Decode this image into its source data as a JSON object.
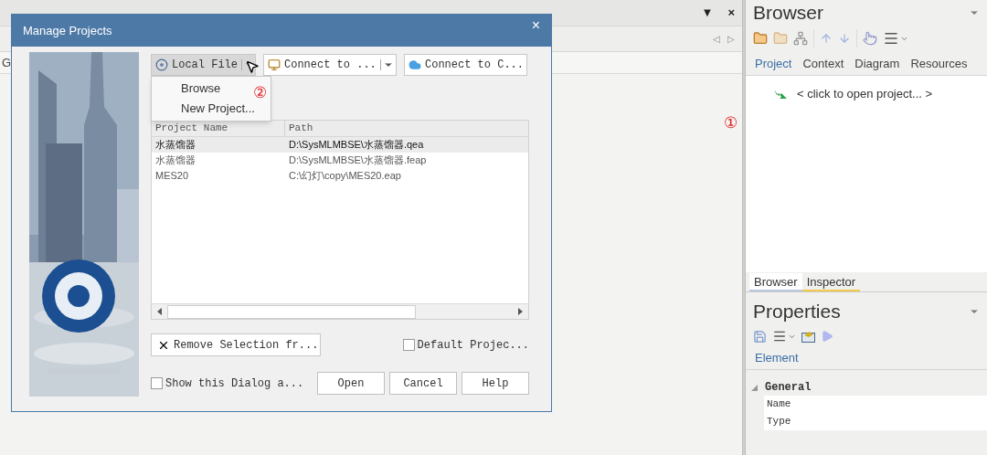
{
  "background": {
    "top_glyphs": [
      "▼",
      "×"
    ],
    "nav_glyphs": [
      "◁",
      "▷"
    ],
    "tab_label": "G"
  },
  "annotations": [
    "①",
    "②"
  ],
  "dialog": {
    "title": "Manage Projects",
    "close": "×",
    "sources": [
      {
        "label": "Local File",
        "kind": "split"
      },
      {
        "label": "Connect to ...",
        "kind": "split"
      },
      {
        "label": "Connect to C...",
        "kind": "plain"
      }
    ],
    "menu": [
      "Browse",
      "New Project..."
    ],
    "columns": [
      "Project Name",
      "Path"
    ],
    "rows": [
      {
        "name": "水蒸馏器",
        "path": "D:\\SysMLMBSE\\水蒸馏器.qea",
        "selected": true
      },
      {
        "name": "水蒸馏器",
        "path": "D:\\SysMLMBSE\\水蒸馏器.feap",
        "selected": false
      },
      {
        "name": "MES20",
        "path": "C:\\幻灯\\copy\\MES20.eap",
        "selected": false
      }
    ],
    "remove_button": "Remove Selection fr...",
    "default_checkbox": {
      "label": "Default Projec...",
      "checked": false
    },
    "show_checkbox": {
      "label": "Show this Dialog a...",
      "checked": false
    },
    "buttons": [
      "Open",
      "Cancel",
      "Help"
    ]
  },
  "browser": {
    "title": "Browser",
    "tabs": [
      {
        "label": "Project",
        "selected": true
      },
      {
        "label": "Context",
        "selected": false
      },
      {
        "label": "Diagram",
        "selected": false
      },
      {
        "label": "Resources",
        "selected": false
      }
    ],
    "item": "< click to open project... >",
    "bottom_tabs": [
      {
        "label": "Browser",
        "selected": true
      },
      {
        "label": "Inspector",
        "selected": false
      }
    ]
  },
  "properties": {
    "title": "Properties",
    "tabs": [
      {
        "label": "Element",
        "selected": true
      }
    ],
    "group": {
      "label": "General",
      "expanded": true,
      "fields": [
        "Name",
        "Type"
      ]
    }
  }
}
